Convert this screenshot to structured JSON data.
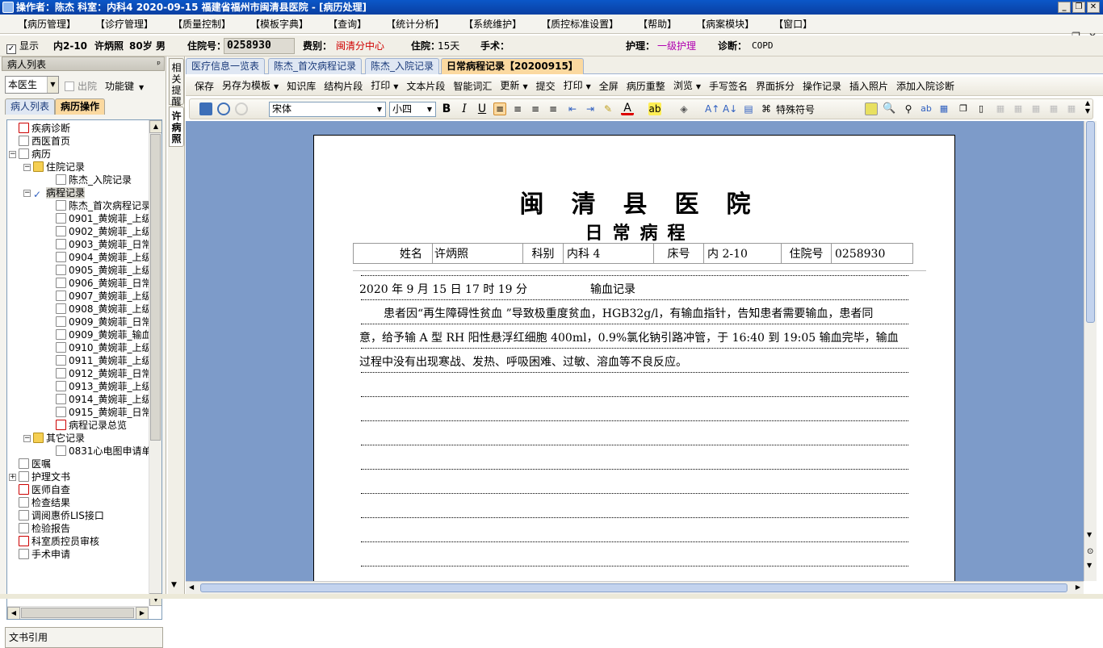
{
  "title": "操作者：陈杰  科室：内科4  2020-09-15  福建省福州市闽清县医院 - [病历处理]",
  "window_buttons": [
    "_",
    "❐",
    "✕"
  ],
  "mdi_buttons": [
    "_",
    "❐",
    "✕"
  ],
  "menu": [
    "【病历管理】",
    "【诊疗管理】",
    "【质量控制】",
    "【模板字典】",
    "【查询】",
    "【统计分析】",
    "【系统维护】",
    "【质控标准设置】",
    "【帮助】",
    "【病案模块】",
    "【窗口】"
  ],
  "infobar": {
    "show_label": "显示",
    "bed": "内2-10",
    "name": "许炳照",
    "age": "80岁",
    "sex": "男",
    "admission_no_label": "住院号：",
    "admission_no": "0258930",
    "fee_label": "费别：",
    "fee": "闽清分中心",
    "stay_label": "住院：",
    "stay": "15天",
    "surgery_label": "手术：",
    "nursing_label": "护理：",
    "nursing": "一级护理",
    "diagnosis_label": "诊断：",
    "diagnosis": "COPD"
  },
  "left_panel": {
    "header": "病人列表",
    "pin": "ᵖ",
    "doctor_filter": "本医生",
    "discharged_label": "出院",
    "function_key": "功能键",
    "tabs": [
      "病人列表",
      "病历操作"
    ],
    "tree": [
      {
        "label": "疾病诊断",
        "level": 1,
        "icon": "red-doc-icon"
      },
      {
        "label": "西医首页",
        "level": 1,
        "icon": "doc-icon"
      },
      {
        "label": "病历",
        "level": 1,
        "icon": "record-icon",
        "expander": "−"
      },
      {
        "label": "住院记录",
        "level": 2,
        "icon": "folder-icon",
        "expander": "−"
      },
      {
        "label": "陈杰_入院记录",
        "level": 3,
        "icon": "doc-icon"
      },
      {
        "label": "病程记录",
        "level": 2,
        "icon": "check-icon",
        "expander": "−",
        "selected": true
      },
      {
        "label": "陈杰_首次病程记录",
        "level": 3,
        "icon": "doc-icon"
      },
      {
        "label": "0901_黄婉菲_上级",
        "level": 3,
        "icon": "doc-icon"
      },
      {
        "label": "0902_黄婉菲_上级",
        "level": 3,
        "icon": "doc-icon"
      },
      {
        "label": "0903_黄婉菲_日常",
        "level": 3,
        "icon": "doc-icon"
      },
      {
        "label": "0904_黄婉菲_上级",
        "level": 3,
        "icon": "doc-icon"
      },
      {
        "label": "0905_黄婉菲_上级",
        "level": 3,
        "icon": "doc-icon"
      },
      {
        "label": "0906_黄婉菲_日常",
        "level": 3,
        "icon": "doc-icon"
      },
      {
        "label": "0907_黄婉菲_上级",
        "level": 3,
        "icon": "doc-icon"
      },
      {
        "label": "0908_黄婉菲_上级",
        "level": 3,
        "icon": "doc-icon"
      },
      {
        "label": "0909_黄婉菲_日常",
        "level": 3,
        "icon": "doc-icon"
      },
      {
        "label": "0909_黄婉菲_输血",
        "level": 3,
        "icon": "doc-icon"
      },
      {
        "label": "0910_黄婉菲_上级",
        "level": 3,
        "icon": "doc-icon"
      },
      {
        "label": "0911_黄婉菲_上级",
        "level": 3,
        "icon": "doc-icon"
      },
      {
        "label": "0912_黄婉菲_日常",
        "level": 3,
        "icon": "doc-icon"
      },
      {
        "label": "0913_黄婉菲_上级",
        "level": 3,
        "icon": "doc-icon"
      },
      {
        "label": "0914_黄婉菲_上级",
        "level": 3,
        "icon": "doc-icon"
      },
      {
        "label": "0915_黄婉菲_日常",
        "level": 3,
        "icon": "doc-icon"
      },
      {
        "label": "病程记录总览",
        "level": 3,
        "icon": "red-doc-icon"
      },
      {
        "label": "其它记录",
        "level": 2,
        "icon": "folder-icon",
        "expander": "−"
      },
      {
        "label": "0831心电图申请单",
        "level": 3,
        "icon": "doc-icon"
      },
      {
        "label": "医嘱",
        "level": 1,
        "icon": "pen-icon"
      },
      {
        "label": "护理文书",
        "level": 1,
        "icon": "doc-icon",
        "expander": "+"
      },
      {
        "label": "医师自查",
        "level": 1,
        "icon": "red-doc-icon"
      },
      {
        "label": "检查结果",
        "level": 1,
        "icon": "magnifier-icon"
      },
      {
        "label": "调阅惠侨LIS接口",
        "level": 1,
        "icon": "doc-icon"
      },
      {
        "label": "检验报告",
        "level": 1,
        "icon": "pen-icon"
      },
      {
        "label": "科室质控员审核",
        "level": 1,
        "icon": "red-doc-icon"
      },
      {
        "label": "手术申请",
        "level": 1,
        "icon": "pen-icon"
      }
    ],
    "bottom": "文书引用"
  },
  "side_tabs": [
    "相关提醒",
    "许病照"
  ],
  "doc_tabs": [
    "医疗信息一览表",
    "陈杰_首次病程记录",
    "陈杰_入院记录",
    "日常病程记录【20200915】"
  ],
  "toolbar1": [
    {
      "label": "保存"
    },
    {
      "label": "另存为模板",
      "dropdown": true
    },
    {
      "label": "知识库"
    },
    {
      "label": "结构片段"
    },
    {
      "label": "打印",
      "dropdown": true
    },
    {
      "label": "文本片段"
    },
    {
      "label": "智能词汇"
    },
    {
      "label": "更新",
      "dropdown": true
    },
    {
      "label": "提交"
    },
    {
      "label": "打印",
      "dropdown": true
    },
    {
      "label": "全屏"
    },
    {
      "label": "病历重整"
    },
    {
      "label": "浏览",
      "dropdown": true
    },
    {
      "label": "手写签名"
    },
    {
      "label": "界面拆分"
    },
    {
      "label": "操作记录"
    },
    {
      "label": "插入照片"
    },
    {
      "label": "添加入院诊断"
    }
  ],
  "toolbar2": {
    "font": "宋体",
    "size": "小四",
    "special_symbol": "特殊符号"
  },
  "document": {
    "hospital": "闽清县医院",
    "subtitle": "日常病程",
    "patient_table": [
      {
        "label": "姓名",
        "value": "许炳照"
      },
      {
        "label": "科别",
        "value": "内科 4"
      },
      {
        "label": "床号",
        "value": "内 2-10"
      },
      {
        "label": "住院号",
        "value": "0258930"
      }
    ],
    "record_time": "2020 年 9 月 15 日 17 时 19 分",
    "record_type": "输血记录",
    "body_lines": [
      "患者因“再生障碍性贫血 ”导致极重度贫血，HGB32g/l，有输血指针，告知患者需要输血，患者同",
      "意，给予输 A 型 RH 阳性悬浮红细胞 400ml，0.9%氯化钠引路冲管，于 16:40 到 19:05 输血完毕，输血",
      "过程中没有出现寒战、发热、呼吸困难、过敏、溶血等不良反应。"
    ]
  },
  "colors": {
    "titlebar": "#0b57c8",
    "editor_bg": "#7d9bc9",
    "active_tab": "#fbd9a0",
    "highlight_red": "#d00000"
  }
}
